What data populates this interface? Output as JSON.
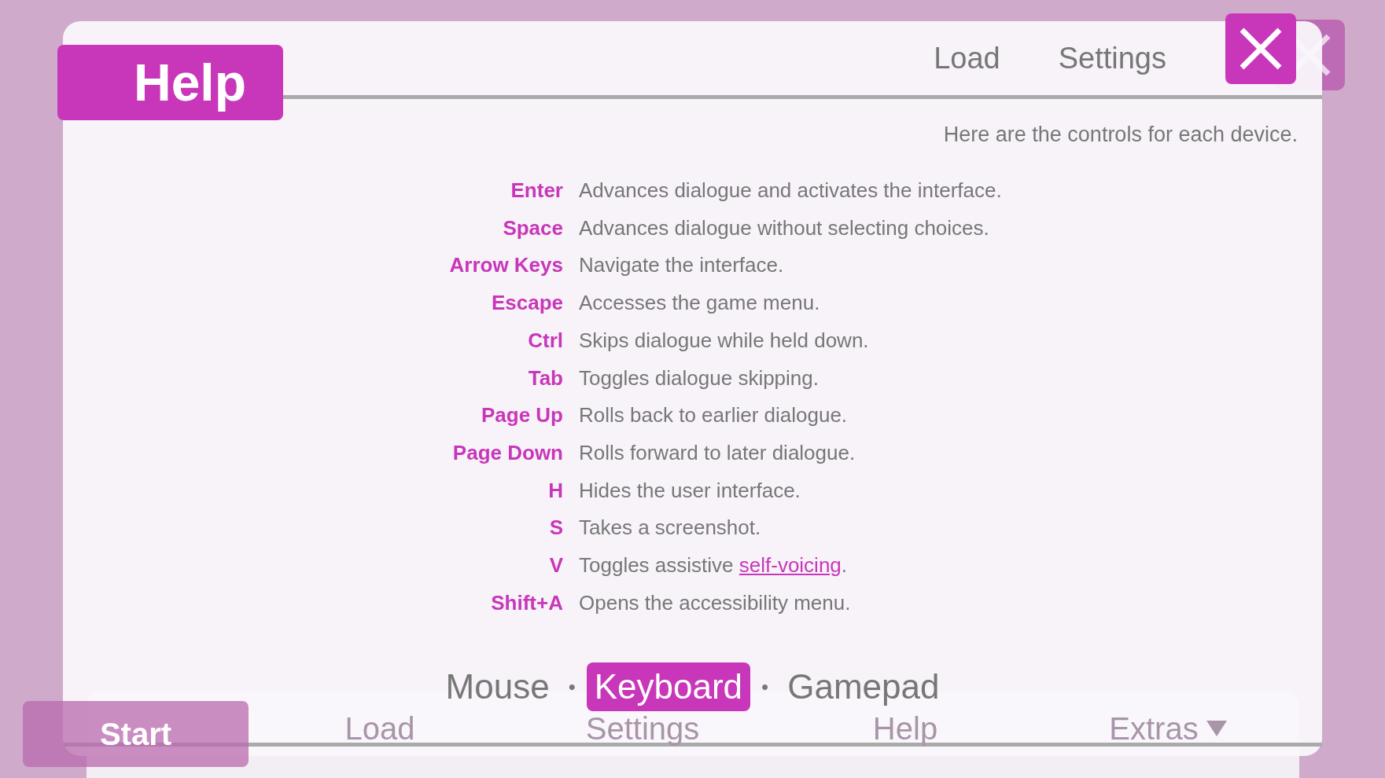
{
  "background_menu": {
    "items": [
      {
        "label": "Start",
        "selected": true
      },
      {
        "label": "Load",
        "selected": false
      },
      {
        "label": "Settings",
        "selected": false
      },
      {
        "label": "Help",
        "selected": false
      },
      {
        "label": "Extras",
        "selected": false
      }
    ]
  },
  "dialog": {
    "title": "Help",
    "nav": [
      {
        "label": "Load"
      },
      {
        "label": "Settings"
      }
    ],
    "intro": "Here are the controls for each device.",
    "controls": [
      {
        "key": "Enter",
        "description": "Advances dialogue and activates the interface."
      },
      {
        "key": "Space",
        "description": "Advances dialogue without selecting choices."
      },
      {
        "key": "Arrow Keys",
        "description": "Navigate the interface."
      },
      {
        "key": "Escape",
        "description": "Accesses the game menu."
      },
      {
        "key": "Ctrl",
        "description": "Skips dialogue while held down."
      },
      {
        "key": "Tab",
        "description": "Toggles dialogue skipping."
      },
      {
        "key": "Page Up",
        "description": "Rolls back to earlier dialogue."
      },
      {
        "key": "Page Down",
        "description": "Rolls forward to later dialogue."
      },
      {
        "key": "H",
        "description": "Hides the user interface."
      },
      {
        "key": "S",
        "description": "Takes a screenshot."
      },
      {
        "key": "V",
        "description": "Toggles assistive ",
        "link": "self-voicing",
        "after": "."
      },
      {
        "key": "Shift+A",
        "description": "Opens the accessibility menu."
      }
    ],
    "devices": [
      {
        "label": "Mouse",
        "selected": false
      },
      {
        "label": "Keyboard",
        "selected": true
      },
      {
        "label": "Gamepad",
        "selected": false
      }
    ],
    "device_separators": [
      "•",
      "•"
    ]
  }
}
